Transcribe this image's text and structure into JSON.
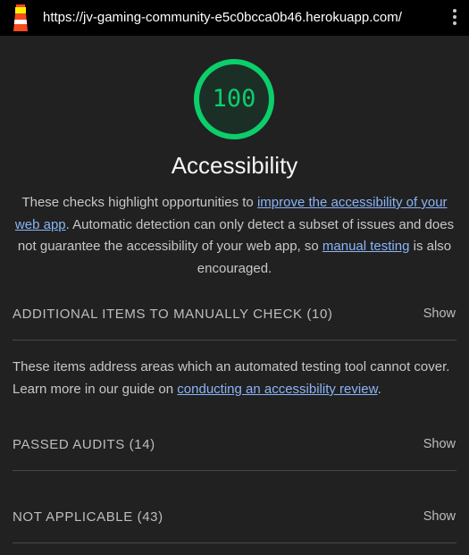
{
  "browser": {
    "url": "https://jv-gaming-community-e5c0bcca0b46.herokuapp.com/",
    "menu_icon": "kebab-menu-icon",
    "logo_icon": "lighthouse-icon"
  },
  "category": {
    "score": "100",
    "score_value": 100,
    "score_color": "#0cce6b",
    "title": "Accessibility",
    "description": {
      "part1": "These checks highlight opportunities to ",
      "link1": "improve the accessibility of your web app",
      "part2": ". Automatic detection can only detect a subset of issues and does not guarantee the accessibility of your web app, so ",
      "link2": "manual testing",
      "part3": " is also encouraged."
    }
  },
  "groups": {
    "manual": {
      "title": "ADDITIONAL ITEMS TO MANUALLY CHECK (10)",
      "toggle": "Show",
      "description": {
        "part1": "These items address areas which an automated testing tool cannot cover. Learn more in our guide on ",
        "link": "conducting an accessibility review",
        "part2": "."
      }
    },
    "passed": {
      "title": "PASSED AUDITS (14)",
      "toggle": "Show"
    },
    "not_applicable": {
      "title": "NOT APPLICABLE (43)",
      "toggle": "Show"
    }
  }
}
